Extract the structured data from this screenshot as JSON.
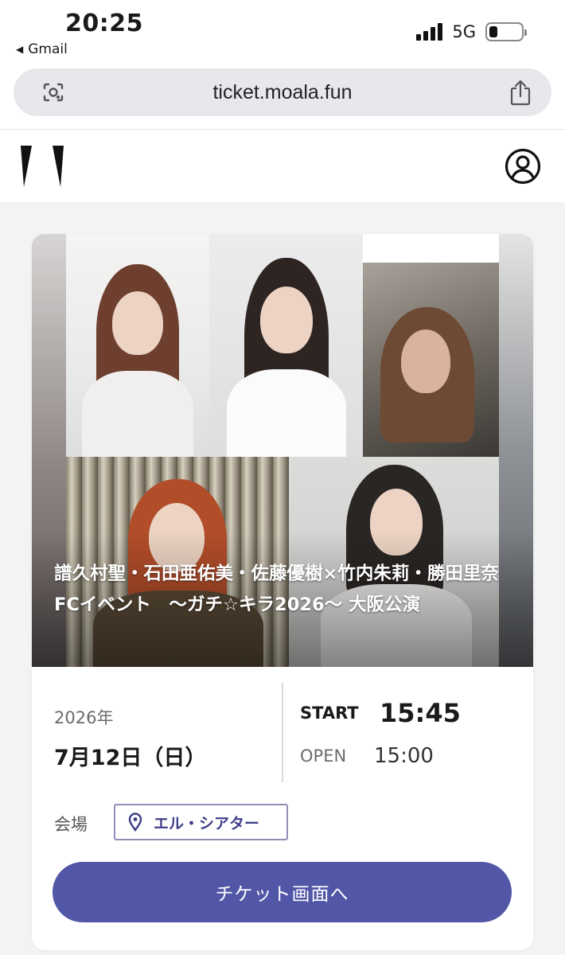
{
  "status_bar": {
    "time": "20:25",
    "back_app": "Gmail",
    "network": "5G",
    "battery_level": 0.25
  },
  "browser": {
    "url": "ticket.moala.fun",
    "icons": [
      "lens-icon",
      "share-icon"
    ]
  },
  "site_header": {
    "icons": [
      "logo",
      "account-icon"
    ]
  },
  "event": {
    "title": "譜久村聖・石田亜佑美・佐藤優樹×竹内朱莉・勝田里奈FCイベント　～ガチ☆キラ2026～ 大阪公演",
    "year": "2026年",
    "date": "7月12日（日）",
    "start_label": "START",
    "start_time": "15:45",
    "open_label": "OPEN",
    "open_time": "15:00",
    "venue_label": "会場",
    "venue_name": "エル・シアター",
    "ticket_button": "チケット画面へ"
  },
  "colors": {
    "accent": "#5156a7",
    "venue_chip_border": "#8f8fb8",
    "venue_text": "#3f3f8a",
    "page_background": "#f3f3f3"
  }
}
